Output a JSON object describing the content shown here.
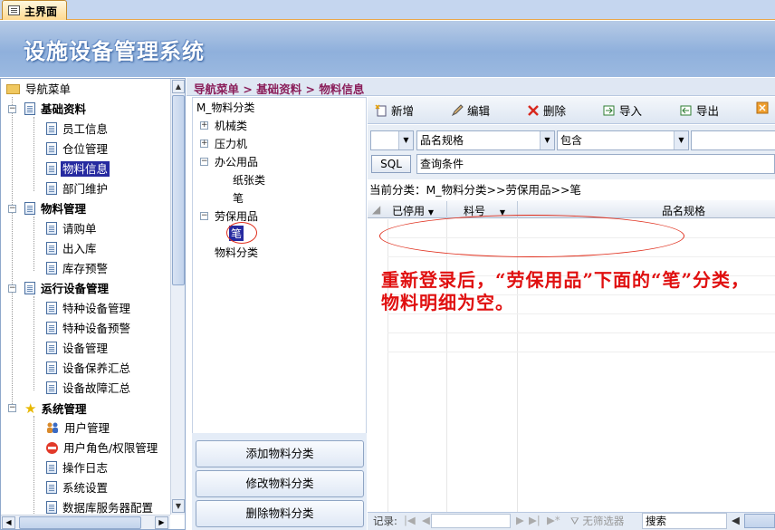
{
  "tab": {
    "label": "主界面"
  },
  "banner": {
    "title": "设施设备管理系统"
  },
  "nav": {
    "root": "导航菜单",
    "groups": [
      {
        "label": "基础资料",
        "items": [
          "员工信息",
          "仓位管理",
          "物料信息",
          "部门维护"
        ]
      },
      {
        "label": "物料管理",
        "items": [
          "请购单",
          "出入库",
          "库存预警"
        ]
      },
      {
        "label": "运行设备管理",
        "items": [
          "特种设备管理",
          "特种设备预警",
          "设备管理",
          "设备保养汇总",
          "设备故障汇总"
        ]
      },
      {
        "label": "系统管理",
        "items": [
          "用户管理",
          "用户角色/权限管理",
          "操作日志",
          "系统设置",
          "数据库服务器配置"
        ]
      }
    ],
    "selected": "物料信息"
  },
  "breadcrumb": "导航菜单 > 基础资料 > 物料信息",
  "category_tree": {
    "root": "M_物料分类",
    "nodes": [
      "机械类",
      "压力机",
      "办公用品",
      "纸张类",
      "笔",
      "劳保用品",
      "笔",
      "物料分类"
    ]
  },
  "category_buttons": {
    "add": "添加物料分类",
    "edit": "修改物料分类",
    "delete": "删除物料分类"
  },
  "toolbar": {
    "new": "新增",
    "edit": "编辑",
    "delete": "删除",
    "import": "导入",
    "export": "导出"
  },
  "filter": {
    "field": "品名规格",
    "operator": "包含",
    "sql": "SQL",
    "query_placeholder": "查询条件"
  },
  "current_category": "当前分类：M_物料分类>>劳保用品>>笔",
  "grid": {
    "columns": [
      "已停用",
      "料号",
      "品名规格"
    ]
  },
  "statusbar": {
    "record_label": "记录:",
    "no_filter": "无筛选器",
    "search": "搜索"
  },
  "annotation": {
    "text": "重新登录后，“劳保用品”下面的“笔”分类，物料明细为空。"
  },
  "colors": {
    "annotation": "#e01010",
    "breadcrumb": "#8a1e5a",
    "selection": "#262aa0"
  }
}
